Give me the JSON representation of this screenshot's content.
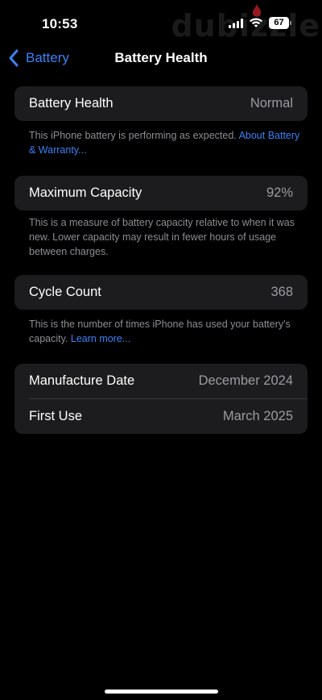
{
  "status_bar": {
    "time": "10:53",
    "battery_level": "67",
    "watermark": "dubizzle",
    "icons": [
      "signal-icon",
      "wifi-icon",
      "battery-icon"
    ]
  },
  "nav": {
    "back_label": "Battery",
    "title": "Battery Health"
  },
  "battery_health": {
    "label": "Battery Health",
    "value": "Normal",
    "footer_text": "This iPhone battery is performing as expected. ",
    "footer_link": "About Battery & Warranty..."
  },
  "maximum_capacity": {
    "label": "Maximum Capacity",
    "value": "92%",
    "footer_text": "This is a measure of battery capacity relative to when it was new. Lower capacity may result in fewer hours of usage between charges."
  },
  "cycle_count": {
    "label": "Cycle Count",
    "value": "368",
    "footer_text": "This is the number of times iPhone has used your battery's capacity. ",
    "footer_link": "Learn more..."
  },
  "dates": {
    "manufacture_label": "Manufacture Date",
    "manufacture_value": "December 2024",
    "first_use_label": "First Use",
    "first_use_value": "March 2025"
  },
  "colors": {
    "background": "#000000",
    "group_background": "#1c1c1e",
    "accent": "#3a82f7",
    "secondary_text": "#9b9ba1"
  }
}
